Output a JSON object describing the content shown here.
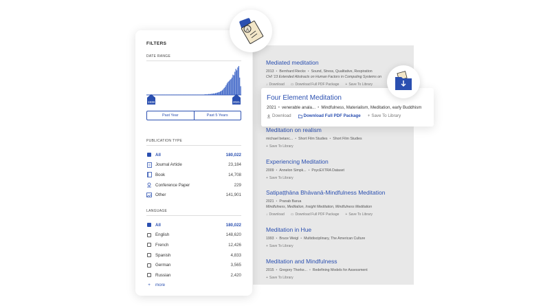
{
  "filters": {
    "title": "FILTERS",
    "date_range": {
      "label": "DATE RANGE",
      "start": "1938",
      "end": "2021",
      "buttons": [
        "Past Year",
        "Past 5 Years"
      ]
    },
    "publication_type": {
      "label": "PUBLICATION TYPE",
      "items": [
        {
          "label": "All",
          "count": "180,022",
          "icon": "check-icon",
          "active": true
        },
        {
          "label": "Journal Article",
          "count": "23,184",
          "icon": "journal-icon"
        },
        {
          "label": "Book",
          "count": "14,708",
          "icon": "book-icon"
        },
        {
          "label": "Conference Paper",
          "count": "229",
          "icon": "conference-icon"
        },
        {
          "label": "Other",
          "count": "141,901",
          "icon": "image-icon"
        }
      ]
    },
    "language": {
      "label": "LANGUAGE",
      "items": [
        {
          "label": "All",
          "count": "180,022",
          "active": true
        },
        {
          "label": "English",
          "count": "148,620"
        },
        {
          "label": "French",
          "count": "12,426"
        },
        {
          "label": "Spanish",
          "count": "4,833"
        },
        {
          "label": "German",
          "count": "3,565"
        },
        {
          "label": "Russian",
          "count": "2,420"
        }
      ],
      "more": "more"
    }
  },
  "results": [
    {
      "title": "Mediated meditation",
      "meta": [
        "2013",
        "Bernhard Rieckx",
        "Sound, Stress, Qualitative, Respiration"
      ],
      "meta2": "CHI '13 Extended Abstracts on Human Factors in Computing Systems on",
      "actions": [
        "Download",
        "Download Full PDF Package",
        "Save To Library"
      ]
    },
    {
      "title": "Meditation on realism",
      "meta": [
        "michael betanc...",
        "Short Film Studies",
        "Short Film Studies"
      ],
      "actions": [
        "Save To Library"
      ]
    },
    {
      "title": "Experiencing Meditation",
      "meta": [
        "2009",
        "Annelon Simpk...",
        "PsycEXTRA Dataset"
      ],
      "actions": [
        "Save To Library"
      ]
    },
    {
      "title": "Satipaṭṭhāna Bhāvanā-Mindfulness Meditation",
      "meta": [
        "2021",
        "Pranab Barua"
      ],
      "meta2": "Mindfulness, Meditation, Insight Meditation, Mindfulness Meditation",
      "actions": [
        "Download",
        "Download Full PDF Package",
        "Save To Library"
      ]
    },
    {
      "title": "Meditation in Hue",
      "meta": [
        "1993",
        "Bruce Weigl",
        "Multidisciplinary, The American Culture"
      ],
      "actions": [
        "Save To Library"
      ]
    },
    {
      "title": "Meditation and Mindfulness",
      "meta": [
        "2015",
        "Gregory Thorke...",
        "Redefining Models for Assessment"
      ],
      "actions": [
        "Save To Library"
      ]
    }
  ],
  "highlight": {
    "title": "Four Element Meditation",
    "year": "2021",
    "author": "venerable anala...",
    "tags": "Mindfulness, Materialism, Meditation, early Buddhism",
    "download": "Download",
    "download_pdf": "Download Full PDF Package",
    "save": "Save To Library"
  },
  "colors": {
    "accent": "#2a4fb0",
    "panel": "#e8e8e8"
  },
  "histogram": [
    1,
    1,
    1,
    1,
    1,
    1,
    1,
    1,
    1,
    1,
    1,
    1,
    1,
    1,
    1,
    1,
    1,
    1,
    1,
    1,
    1,
    1,
    1,
    1,
    1,
    1,
    1,
    1,
    1,
    1,
    1,
    1,
    1,
    1,
    1,
    1,
    1,
    1,
    1,
    1,
    1,
    1,
    1,
    1,
    1,
    1,
    1,
    1,
    1,
    1,
    1,
    1,
    1,
    1,
    1,
    1,
    1,
    1,
    1,
    1,
    2,
    2,
    2,
    2,
    3,
    3,
    3,
    4,
    4,
    5,
    5,
    6,
    7,
    8,
    9,
    10,
    12,
    14,
    16,
    20,
    24,
    28,
    34,
    40,
    45,
    48,
    52,
    55,
    60,
    70,
    68,
    80,
    90,
    85,
    95,
    100,
    60,
    30
  ]
}
